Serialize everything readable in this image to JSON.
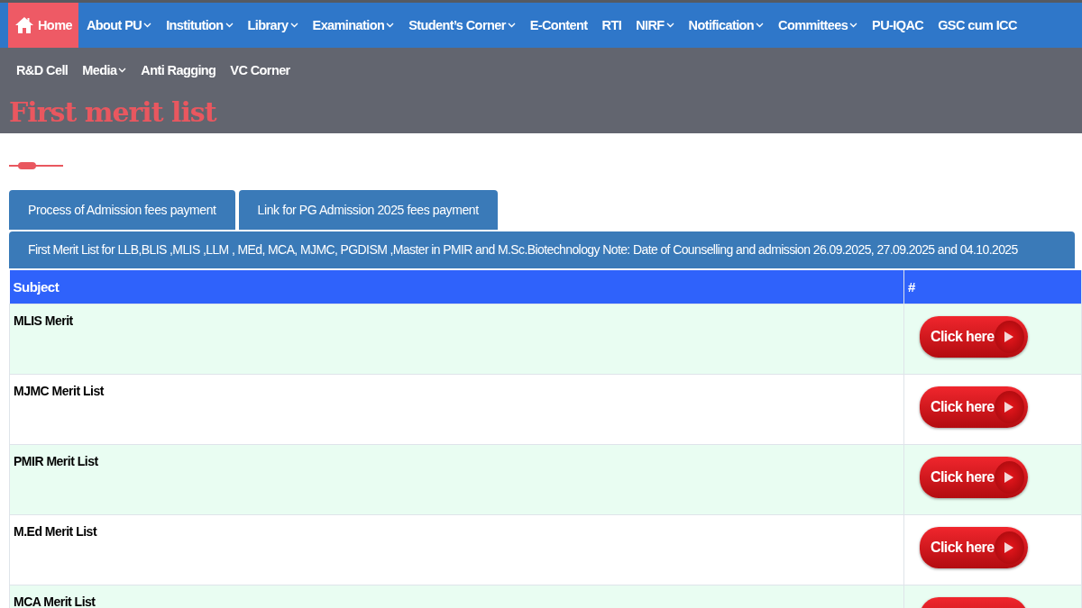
{
  "nav": [
    {
      "label": "Home",
      "selected": true,
      "dropdown": false,
      "home": true
    },
    {
      "label": "About PU",
      "selected": false,
      "dropdown": true
    },
    {
      "label": "Institution",
      "selected": false,
      "dropdown": true
    },
    {
      "label": "Library",
      "selected": false,
      "dropdown": true
    },
    {
      "label": "Examination",
      "selected": false,
      "dropdown": true
    },
    {
      "label": "Student’s Corner",
      "selected": false,
      "dropdown": true
    },
    {
      "label": "E-Content",
      "selected": false,
      "dropdown": false
    },
    {
      "label": "RTI",
      "selected": false,
      "dropdown": false
    },
    {
      "label": "NIRF",
      "selected": false,
      "dropdown": true
    },
    {
      "label": "Notification",
      "selected": false,
      "dropdown": true
    },
    {
      "label": "Committees",
      "selected": false,
      "dropdown": true
    },
    {
      "label": "PU-IQAC",
      "selected": false,
      "dropdown": false
    },
    {
      "label": "GSC cum ICC",
      "selected": false,
      "dropdown": false
    },
    {
      "label": "R&D Cell",
      "selected": false,
      "dropdown": false
    },
    {
      "label": "Media",
      "selected": false,
      "dropdown": true
    },
    {
      "label": "Anti Ragging",
      "selected": false,
      "dropdown": false
    },
    {
      "label": "VC Corner",
      "selected": false,
      "dropdown": false
    }
  ],
  "page_title": "First merit list",
  "tabs": [
    "Process of Admission fees payment",
    "Link for PG Admission 2025 fees payment"
  ],
  "notice": "First Merit List for LLB,BLIS ,MLIS ,LLM , MEd, MCA, MJMC, PGDISM ,Master in PMIR and M.Sc.Biotechnology Note: Date of Counselling and admission 26.09.2025, 27.09.2025 and 04.10.2025",
  "table": {
    "columns": [
      "Subject",
      "#"
    ],
    "rows": [
      {
        "subject": "MLIS Merit",
        "button": "Click here"
      },
      {
        "subject": "MJMC Merit List",
        "button": "Click here"
      },
      {
        "subject": "PMIR Merit List",
        "button": "Click here"
      },
      {
        "subject": "M.Ed Merit List",
        "button": "Click here"
      },
      {
        "subject": "MCA Merit List"
      }
    ]
  }
}
